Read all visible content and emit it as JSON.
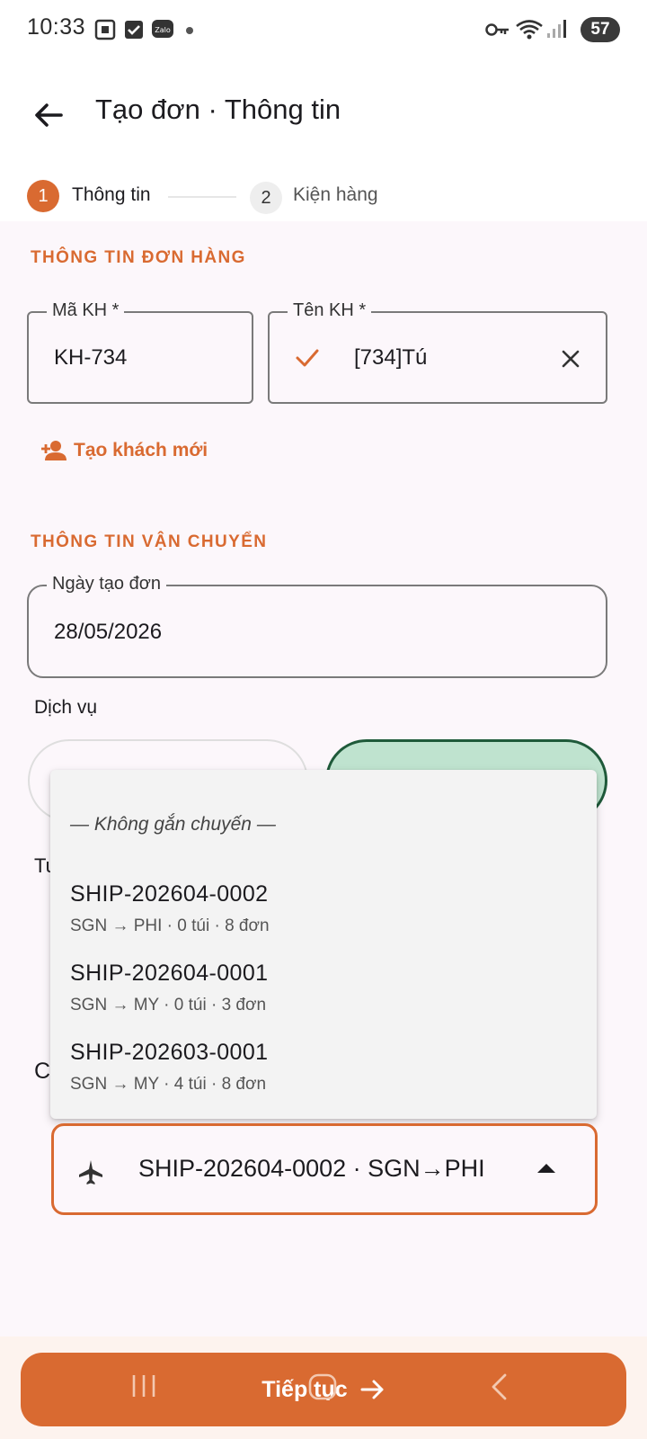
{
  "status_bar": {
    "time": "10:33",
    "battery": "57",
    "icons": [
      "screenshot-icon",
      "checkbox-icon",
      "zalo-icon",
      "dot-icon",
      "key-icon",
      "wifi-icon",
      "signal-icon"
    ]
  },
  "app_bar": {
    "title": "Tạo đơn · Thông tin"
  },
  "stepper": {
    "steps": [
      {
        "number": "1",
        "label": "Thông tin",
        "active": true
      },
      {
        "number": "2",
        "label": "Kiện hàng",
        "active": false
      }
    ]
  },
  "order_section": {
    "title": "THÔNG TIN ĐƠN HÀNG",
    "customer_code": {
      "label": "Mã KH *",
      "value": "KH-734"
    },
    "customer_name": {
      "label": "Tên KH *",
      "value": "[734]Tú"
    },
    "new_customer_link": "Tạo khách mới"
  },
  "shipping_section": {
    "title": "THÔNG TIN VẬN CHUYỂN",
    "order_date": {
      "label": "Ngày tạo đơn",
      "value": "28/05/2026"
    },
    "service_label": "Dịch vụ",
    "partial_label_1": "Tu",
    "partial_label_2": "C"
  },
  "shipment_menu": {
    "none_option": "— Không gắn chuyến —",
    "options": [
      {
        "code": "SHIP-202604-0002",
        "detail": "SGN → PHI · 0 túi · 8 đơn"
      },
      {
        "code": "SHIP-202604-0001",
        "detail": "SGN → MY · 0 túi · 3 đơn"
      },
      {
        "code": "SHIP-202603-0001",
        "detail": "SGN → MY · 4 túi · 8 đơn"
      }
    ]
  },
  "shipment_select": {
    "value": "SHIP-202604-0002 · SGN→PHI"
  },
  "bottom": {
    "continue_label": "Tiếp tục"
  },
  "colors": {
    "accent": "#d96a31",
    "service_selected_bg": "#bfe3cf",
    "service_selected_border": "#1f5a3a"
  }
}
